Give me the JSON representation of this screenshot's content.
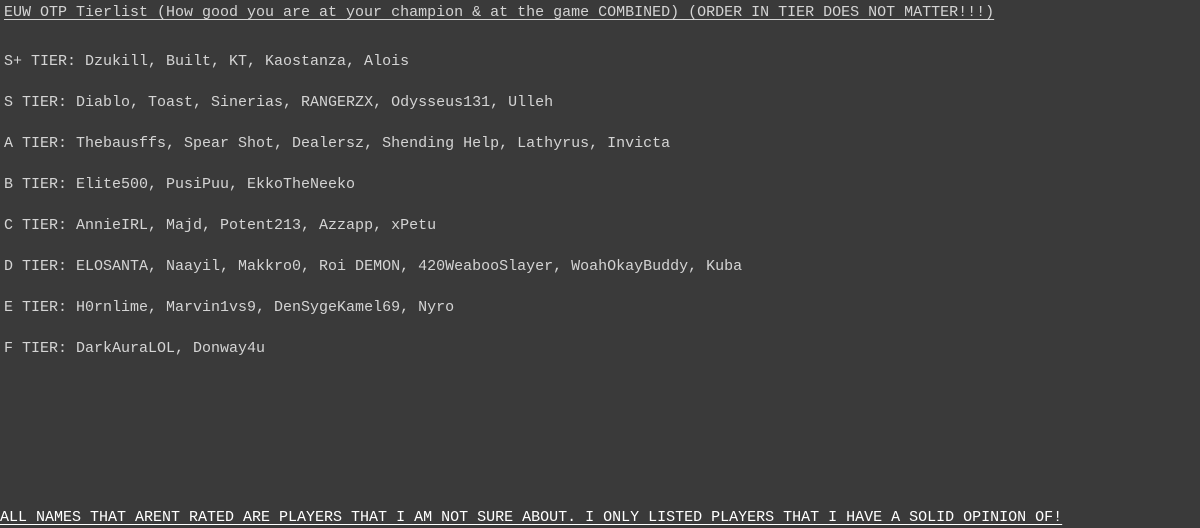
{
  "title": "EUW OTP Tierlist (How good you are at your champion & at the game COMBINED) (ORDER IN TIER DOES NOT MATTER!!!)",
  "tiers": [
    {
      "label": "S+ TIER:",
      "players": "Dzukill, Built, KT, Kaostanza, Alois"
    },
    {
      "label": "S TIER:",
      "players": "Diablo, Toast, Sinerias, RANGERZX, Odysseus131, Ulleh"
    },
    {
      "label": "A TIER:",
      "players": "Thebausffs, Spear Shot, Dealersz, Shending Help, Lathyrus, Invicta"
    },
    {
      "label": "B TIER:",
      "players": "Elite500, PusiPuu, EkkoTheNeeko"
    },
    {
      "label": "C TIER:",
      "players": "AnnieIRL, Majd, Potent213, Azzapp, xPetu"
    },
    {
      "label": "D TIER:",
      "players": "ELOSANTA, Naayil, Makkro0, Roi DEMON, 420WeabooSlayer, WoahOkayBuddy, Kuba"
    },
    {
      "label": "E TIER:",
      "players": "H0rnlime, Marvin1vs9, DenSygeKamel69, Nyro"
    },
    {
      "label": "F TIER:",
      "players": "DarkAuraLOL, Donway4u"
    }
  ],
  "footer": "ALL NAMES THAT ARENT RATED ARE PLAYERS THAT I AM NOT SURE ABOUT. I ONLY LISTED PLAYERS THAT I HAVE A SOLID OPINION OF!"
}
